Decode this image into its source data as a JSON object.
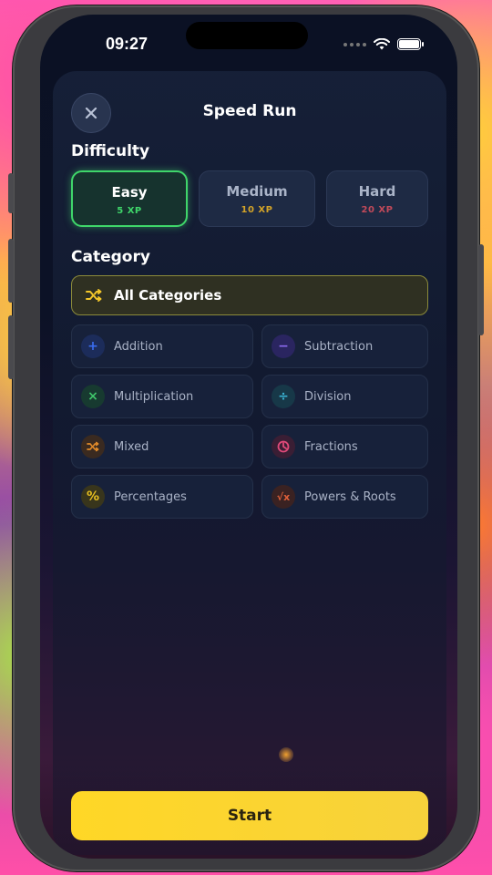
{
  "status_bar": {
    "time": "09:27"
  },
  "sheet": {
    "title": "Speed Run"
  },
  "difficulty": {
    "heading": "Difficulty",
    "options": [
      {
        "label": "Easy",
        "xp": "5 XP",
        "xp_color": "#3fd66a",
        "selected": true
      },
      {
        "label": "Medium",
        "xp": "10 XP",
        "xp_color": "#d4a428",
        "selected": false
      },
      {
        "label": "Hard",
        "xp": "20 XP",
        "xp_color": "#c24a5a",
        "selected": false
      }
    ]
  },
  "category": {
    "heading": "Category",
    "all": {
      "label": "All Categories",
      "icon": "shuffle-icon",
      "selected": true
    },
    "items": [
      {
        "label": "Addition",
        "icon": "plus-icon",
        "glyph": "+",
        "color": "#3a6cf0",
        "bg": "#1c2c5a"
      },
      {
        "label": "Subtraction",
        "icon": "minus-icon",
        "glyph": "−",
        "color": "#8c6af0",
        "bg": "#2a2560"
      },
      {
        "label": "Multiplication",
        "icon": "multiply-icon",
        "glyph": "×",
        "color": "#3fc46a",
        "bg": "#173a30"
      },
      {
        "label": "Division",
        "icon": "divide-icon",
        "glyph": "÷",
        "color": "#3ab0d0",
        "bg": "#173848"
      },
      {
        "label": "Mixed",
        "icon": "shuffle-icon",
        "glyph": "⤭",
        "color": "#e08a2a",
        "bg": "#3a2a20"
      },
      {
        "label": "Fractions",
        "icon": "pie-chart-icon",
        "glyph": "◔",
        "color": "#e04a7a",
        "bg": "#3a1e34"
      },
      {
        "label": "Percentages",
        "icon": "percent-icon",
        "glyph": "%",
        "color": "#e8c020",
        "bg": "#38351c"
      },
      {
        "label": "Powers & Roots",
        "icon": "square-root-icon",
        "glyph": "√x",
        "color": "#e0603a",
        "bg": "#3a2222"
      }
    ]
  },
  "actions": {
    "start_label": "Start",
    "accent": "#ffd726"
  }
}
